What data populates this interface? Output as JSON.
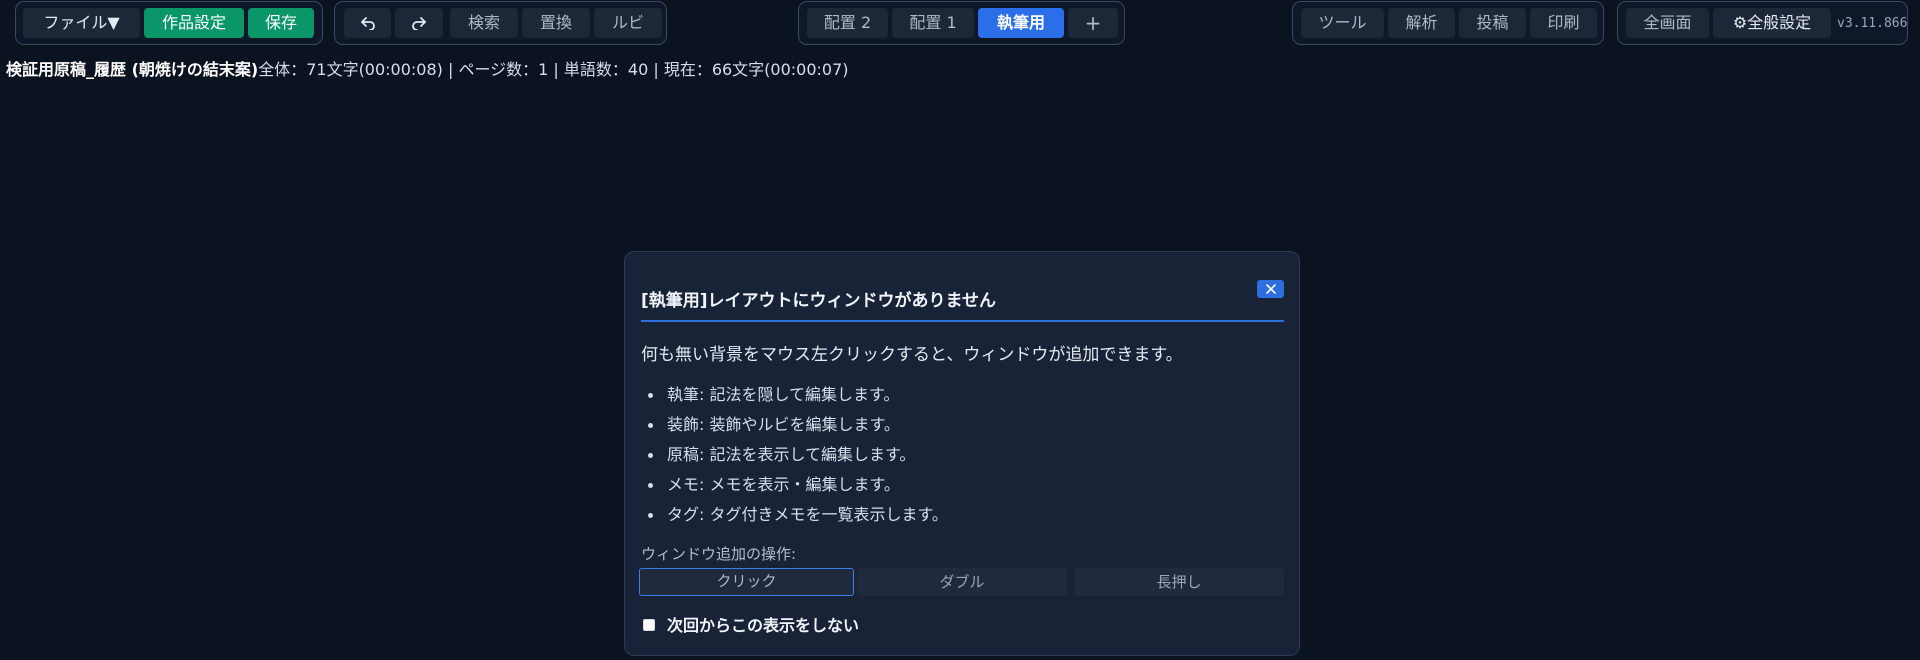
{
  "toolbar": {
    "file_label": "ファイル▼",
    "work_settings_label": "作品設定",
    "save_label": "保存",
    "search_label": "検索",
    "replace_label": "置換",
    "ruby_label": "ルビ",
    "layout_tabs": [
      {
        "label": "配置 2",
        "active": false
      },
      {
        "label": "配置 1",
        "active": false
      },
      {
        "label": "執筆用",
        "active": true
      }
    ],
    "add_layout_label": "+",
    "tools_label": "ツール",
    "analysis_label": "解析",
    "post_label": "投稿",
    "print_label": "印刷",
    "fullscreen_label": "全画面",
    "general_settings_label": "⚙全般設定",
    "version": "v3.11.866"
  },
  "status": {
    "title": "検証用原稿_履歴 (朝焼けの結末案)",
    "info": "全体：71文字(00:00:08) | ページ数：1 | 単語数：40 | 現在：66文字(00:00:07)"
  },
  "dialog": {
    "title": "[執筆用]レイアウトにウィンドウがありません",
    "lead": "何も無い背景をマウス左クリックすると、ウィンドウが追加できます。",
    "items": [
      "執筆: 記法を隠して編集します。",
      "装飾: 装飾やルビを編集します。",
      "原稿: 記法を表示して編集します。",
      "メモ: メモを表示・編集します。",
      "タグ: タグ付きメモを一覧表示します。"
    ],
    "ops_label": "ウィンドウ追加の操作:",
    "ops": [
      {
        "label": "クリック",
        "selected": true
      },
      {
        "label": "ダブル",
        "selected": false
      },
      {
        "label": "長押し",
        "selected": false
      }
    ],
    "dont_show_label": "次回からこの表示をしない",
    "dont_show_checked": false
  },
  "colors": {
    "background": "#0b1220",
    "accent_blue": "#2a6fe8",
    "accent_green": "#0a9668"
  }
}
